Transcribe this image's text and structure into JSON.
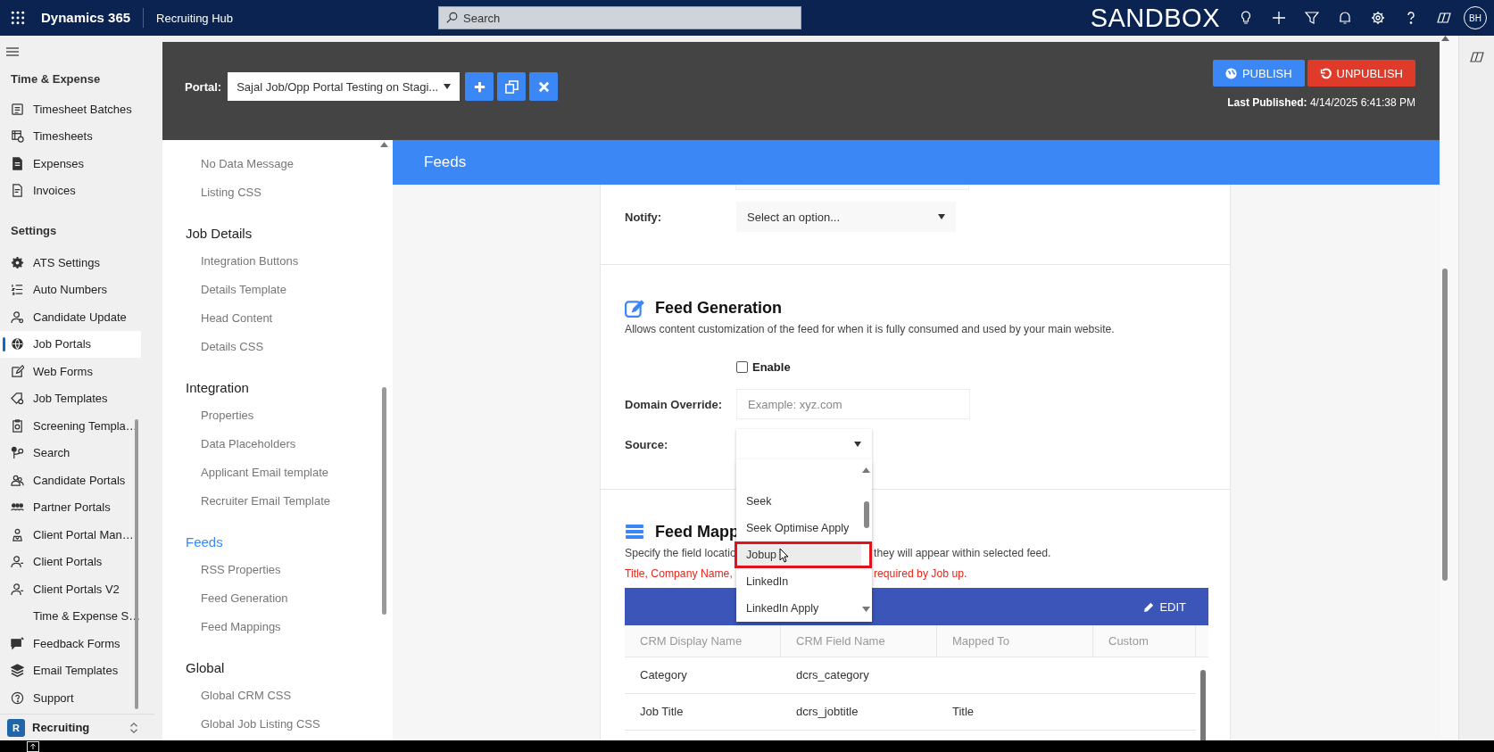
{
  "top_bar": {
    "app_name": "Dynamics 365",
    "area": "Recruiting Hub",
    "search": {
      "placeholder": "Search"
    },
    "environment": "SANDBOX",
    "avatar": "BH"
  },
  "nav": {
    "groups": [
      {
        "title": "Time & Expense",
        "items": [
          {
            "label": "Timesheet Batches",
            "selected": false
          },
          {
            "label": "Timesheets",
            "selected": false
          },
          {
            "label": "Expenses",
            "selected": false
          },
          {
            "label": "Invoices",
            "selected": false
          }
        ]
      },
      {
        "title": "Settings",
        "items": [
          {
            "label": "ATS Settings",
            "selected": false
          },
          {
            "label": "Auto Numbers",
            "selected": false
          },
          {
            "label": "Candidate Update",
            "selected": false
          },
          {
            "label": "Job Portals",
            "selected": true
          },
          {
            "label": "Web Forms",
            "selected": false
          },
          {
            "label": "Job Templates",
            "selected": false
          },
          {
            "label": "Screening Templa…",
            "selected": false
          },
          {
            "label": "Search",
            "selected": false
          },
          {
            "label": "Candidate Portals",
            "selected": false
          },
          {
            "label": "Partner Portals",
            "selected": false
          },
          {
            "label": "Client Portal Man…",
            "selected": false
          },
          {
            "label": "Client Portals",
            "selected": false
          },
          {
            "label": "Client Portals V2",
            "selected": false
          },
          {
            "label": "Time & Expense S…",
            "selected": false
          },
          {
            "label": "Feedback Forms",
            "selected": false
          },
          {
            "label": "Email Templates",
            "selected": false
          },
          {
            "label": "Support",
            "selected": false
          }
        ]
      }
    ],
    "footer": {
      "badge": "R",
      "label": "Recruiting"
    }
  },
  "portal_bar": {
    "label": "Portal:",
    "selected_portal": "Sajal Job/Opp Portal Testing on Stagi...",
    "publish": "PUBLISH",
    "unpublish": "UNPUBLISH",
    "last_published_label": "Last Published:",
    "last_published_value": "4/14/2025 6:41:38 PM"
  },
  "settings_nav": [
    {
      "items": [
        "No Data Message",
        "Listing CSS"
      ]
    },
    {
      "title": "Job Details",
      "selected": false,
      "items": [
        "Integration Buttons",
        "Details Template",
        "Head Content",
        "Details CSS"
      ]
    },
    {
      "title": "Integration",
      "selected": false,
      "items": [
        "Properties",
        "Data Placeholders",
        "Applicant Email template",
        "Recruiter Email Template"
      ]
    },
    {
      "title": "Feeds",
      "selected": true,
      "items": [
        "RSS Properties",
        "Feed Generation",
        "Feed Mappings"
      ]
    },
    {
      "title": "Global",
      "selected": false,
      "items": [
        "Global CRM CSS",
        "Global Job Listing CSS"
      ]
    }
  ],
  "page_title": "Feeds",
  "notify": {
    "label": "Notify:",
    "placeholder": "Select an option..."
  },
  "feed_generation": {
    "title": "Feed Generation",
    "description": "Allows content customization of the feed for when it is fully consumed and used by your main website.",
    "enable": {
      "label": "Enable",
      "checked": false
    },
    "domain_override": {
      "label": "Domain Override:",
      "placeholder": "Example: xyz.com"
    },
    "source": {
      "label": "Source:",
      "expanded": true,
      "options": [
        {
          "label": "Seek",
          "selected": false
        },
        {
          "label": "Seek Optimise Apply",
          "selected": false
        },
        {
          "label": "Jobup",
          "selected": true
        },
        {
          "label": "LinkedIn",
          "selected": false
        },
        {
          "label": "LinkedIn Apply",
          "selected": false
        }
      ]
    }
  },
  "feed_mappings": {
    "title": "Feed Mapp",
    "description_start": "Specify the field locatio",
    "description_end": "they will appear within selected feed.",
    "required_start": "Title, Company Name,",
    "required_end": "required by Job up.",
    "edit": "EDIT",
    "table": {
      "columns": [
        "CRM Display Name",
        "CRM Field Name",
        "Mapped To",
        "Custom"
      ],
      "rows": [
        {
          "crm_display_name": "Category",
          "crm_field_name": "dcrs_category"
        },
        {
          "crm_display_name": "Job Title",
          "crm_field_name": "dcrs_jobtitle",
          "mapped_to": "Title"
        }
      ]
    }
  }
}
